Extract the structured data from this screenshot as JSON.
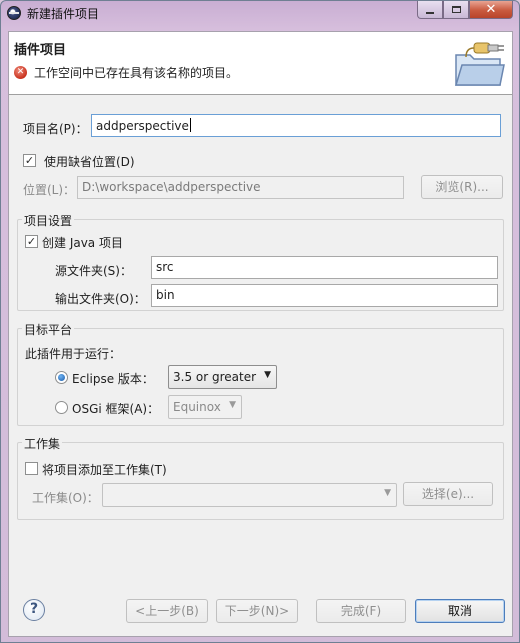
{
  "window": {
    "title": "新建插件项目"
  },
  "header": {
    "title": "插件项目",
    "error_message": "工作空间中已存在具有该名称的项目。"
  },
  "project": {
    "name_label": "项目名(P)：",
    "name_value": "addperspective",
    "use_default_location_label": "使用缺省位置(D)",
    "use_default_location_checked": true,
    "location_label": "位置(L)：",
    "location_value": "D:\\workspace\\addperspective",
    "browse_label": "浏览(R)..."
  },
  "project_settings": {
    "group_title": "项目设置",
    "create_java_label": "创建 Java 项目",
    "create_java_checked": true,
    "source_folder_label": "源文件夹(S)：",
    "source_folder_value": "src",
    "output_folder_label": "输出文件夹(O)：",
    "output_folder_value": "bin"
  },
  "target_platform": {
    "group_title": "目标平台",
    "run_with_label": "此插件用于运行：",
    "eclipse_label": "Eclipse 版本：",
    "eclipse_selected": true,
    "eclipse_version": "3.5 or greater",
    "osgi_label": "OSGi 框架(A)：",
    "osgi_selected": false,
    "osgi_framework": "Equinox"
  },
  "working_sets": {
    "group_title": "工作集",
    "add_label": "将项目添加至工作集(T)",
    "add_checked": false,
    "working_set_label": "工作集(O)：",
    "working_set_value": "",
    "select_label": "选择(e)..."
  },
  "footer": {
    "back_label": "<上一步(B)",
    "next_label": "下一步(N)>",
    "finish_label": "完成(F)",
    "cancel_label": "取消"
  },
  "colors": {
    "error": "#c8321e",
    "accent": "#4d7dbb"
  }
}
